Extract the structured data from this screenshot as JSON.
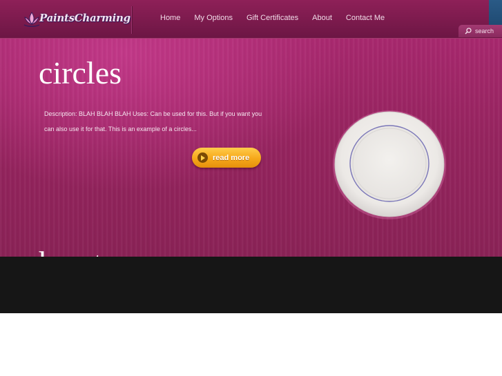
{
  "brand": {
    "logo_text": "PaintsCharming"
  },
  "nav": {
    "items": [
      "Home",
      "My Options",
      "Gift Certificates",
      "About",
      "Contact Me"
    ]
  },
  "search": {
    "label": "search"
  },
  "slide": {
    "title": "circles",
    "description": "Description:  BLAH BLAH BLAH Uses: Can be used for this.  But if you want you can also use it for that. This is an example of a circles...",
    "button_label": "read more"
  },
  "next_slide": {
    "title": "heart"
  },
  "colors": {
    "header": "#7a1a4c",
    "hero": "#96245f",
    "button": "#f6a81a",
    "footer_band": "#161616"
  }
}
